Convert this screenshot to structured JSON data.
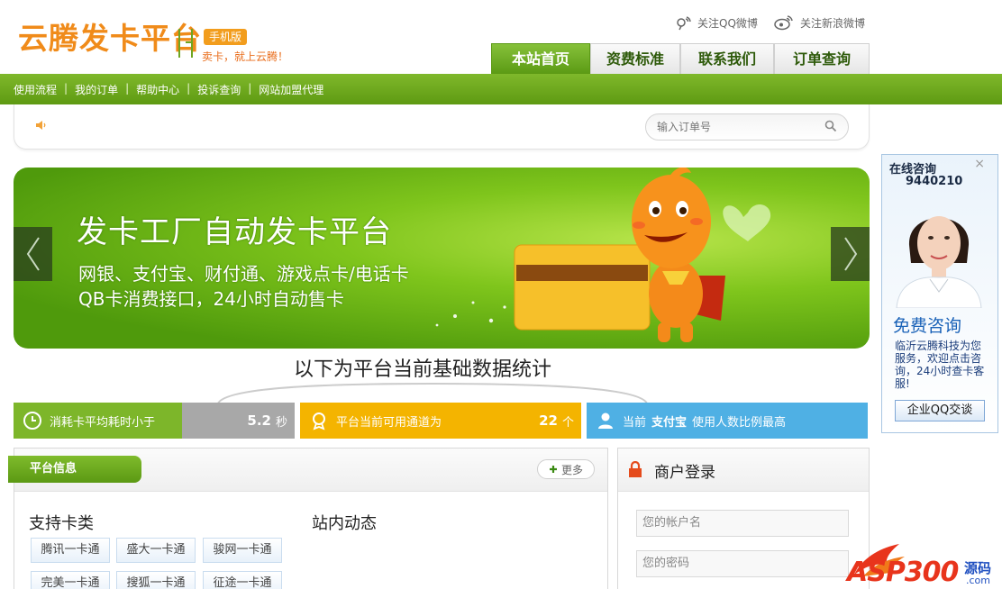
{
  "header": {
    "logo": "云腾发卡平台",
    "mobile_badge": "手机版",
    "slogan": "卖卡，就上云腾！",
    "follow_qq": "关注QQ微博",
    "follow_sina": "关注新浪微博"
  },
  "nav": {
    "tabs": [
      {
        "label": "本站首页"
      },
      {
        "label": "资费标准"
      },
      {
        "label": "联系我们"
      },
      {
        "label": "订单查询"
      }
    ]
  },
  "subnav": {
    "items": [
      {
        "label": "使用流程"
      },
      {
        "label": "我的订单"
      },
      {
        "label": "帮助中心"
      },
      {
        "label": "投诉查询"
      },
      {
        "label": "网站加盟代理"
      }
    ]
  },
  "search": {
    "placeholder": "输入订单号"
  },
  "banner": {
    "title": "发卡工厂自动发卡平台",
    "line1": "网银、支付宝、财付通、游戏点卡/电话卡",
    "line2": "QB卡消费接口，24小时自动售卡"
  },
  "stats": {
    "title": "以下为平台当前基础数据统计",
    "box1_label": "消耗卡平均耗时小于",
    "box1_value": "5.2",
    "box1_unit": "秒",
    "box2_label": "平台当前可用通道为",
    "box2_value": "22",
    "box2_unit": "个",
    "box3_prefix": "当前",
    "box3_strong": "支付宝",
    "box3_suffix": "使用人数比例最高",
    "colors": {
      "gray": "#a8a8a8",
      "green": "#7db62a",
      "yellow": "#f4b400",
      "blue": "#4fb0e4"
    }
  },
  "platform": {
    "tab_label": "平台信息",
    "more": "更多",
    "cards_title": "支持卡类",
    "news_title": "站内动态",
    "cards": [
      {
        "label": "腾讯一卡通"
      },
      {
        "label": "盛大一卡通"
      },
      {
        "label": "骏网一卡通"
      },
      {
        "label": "完美一卡通"
      },
      {
        "label": "搜狐一卡通"
      },
      {
        "label": "征途一卡通"
      }
    ]
  },
  "login": {
    "title": "商户登录",
    "username_placeholder": "您的帐户名",
    "password_placeholder": "您的密码"
  },
  "float": {
    "title": "在线咨询",
    "number": "9440210",
    "free": "免费咨询",
    "desc": "临沂云腾科技为您服务，欢迎点击咨询，24小时查卡客服!",
    "button": "企业QQ交谈",
    "close": "×"
  },
  "watermark": {
    "text": "ASP300",
    "sub": "源码",
    "domain": ".com"
  },
  "colors": {
    "brand_green": "#6aa81d",
    "brand_orange": "#f08b1a"
  }
}
